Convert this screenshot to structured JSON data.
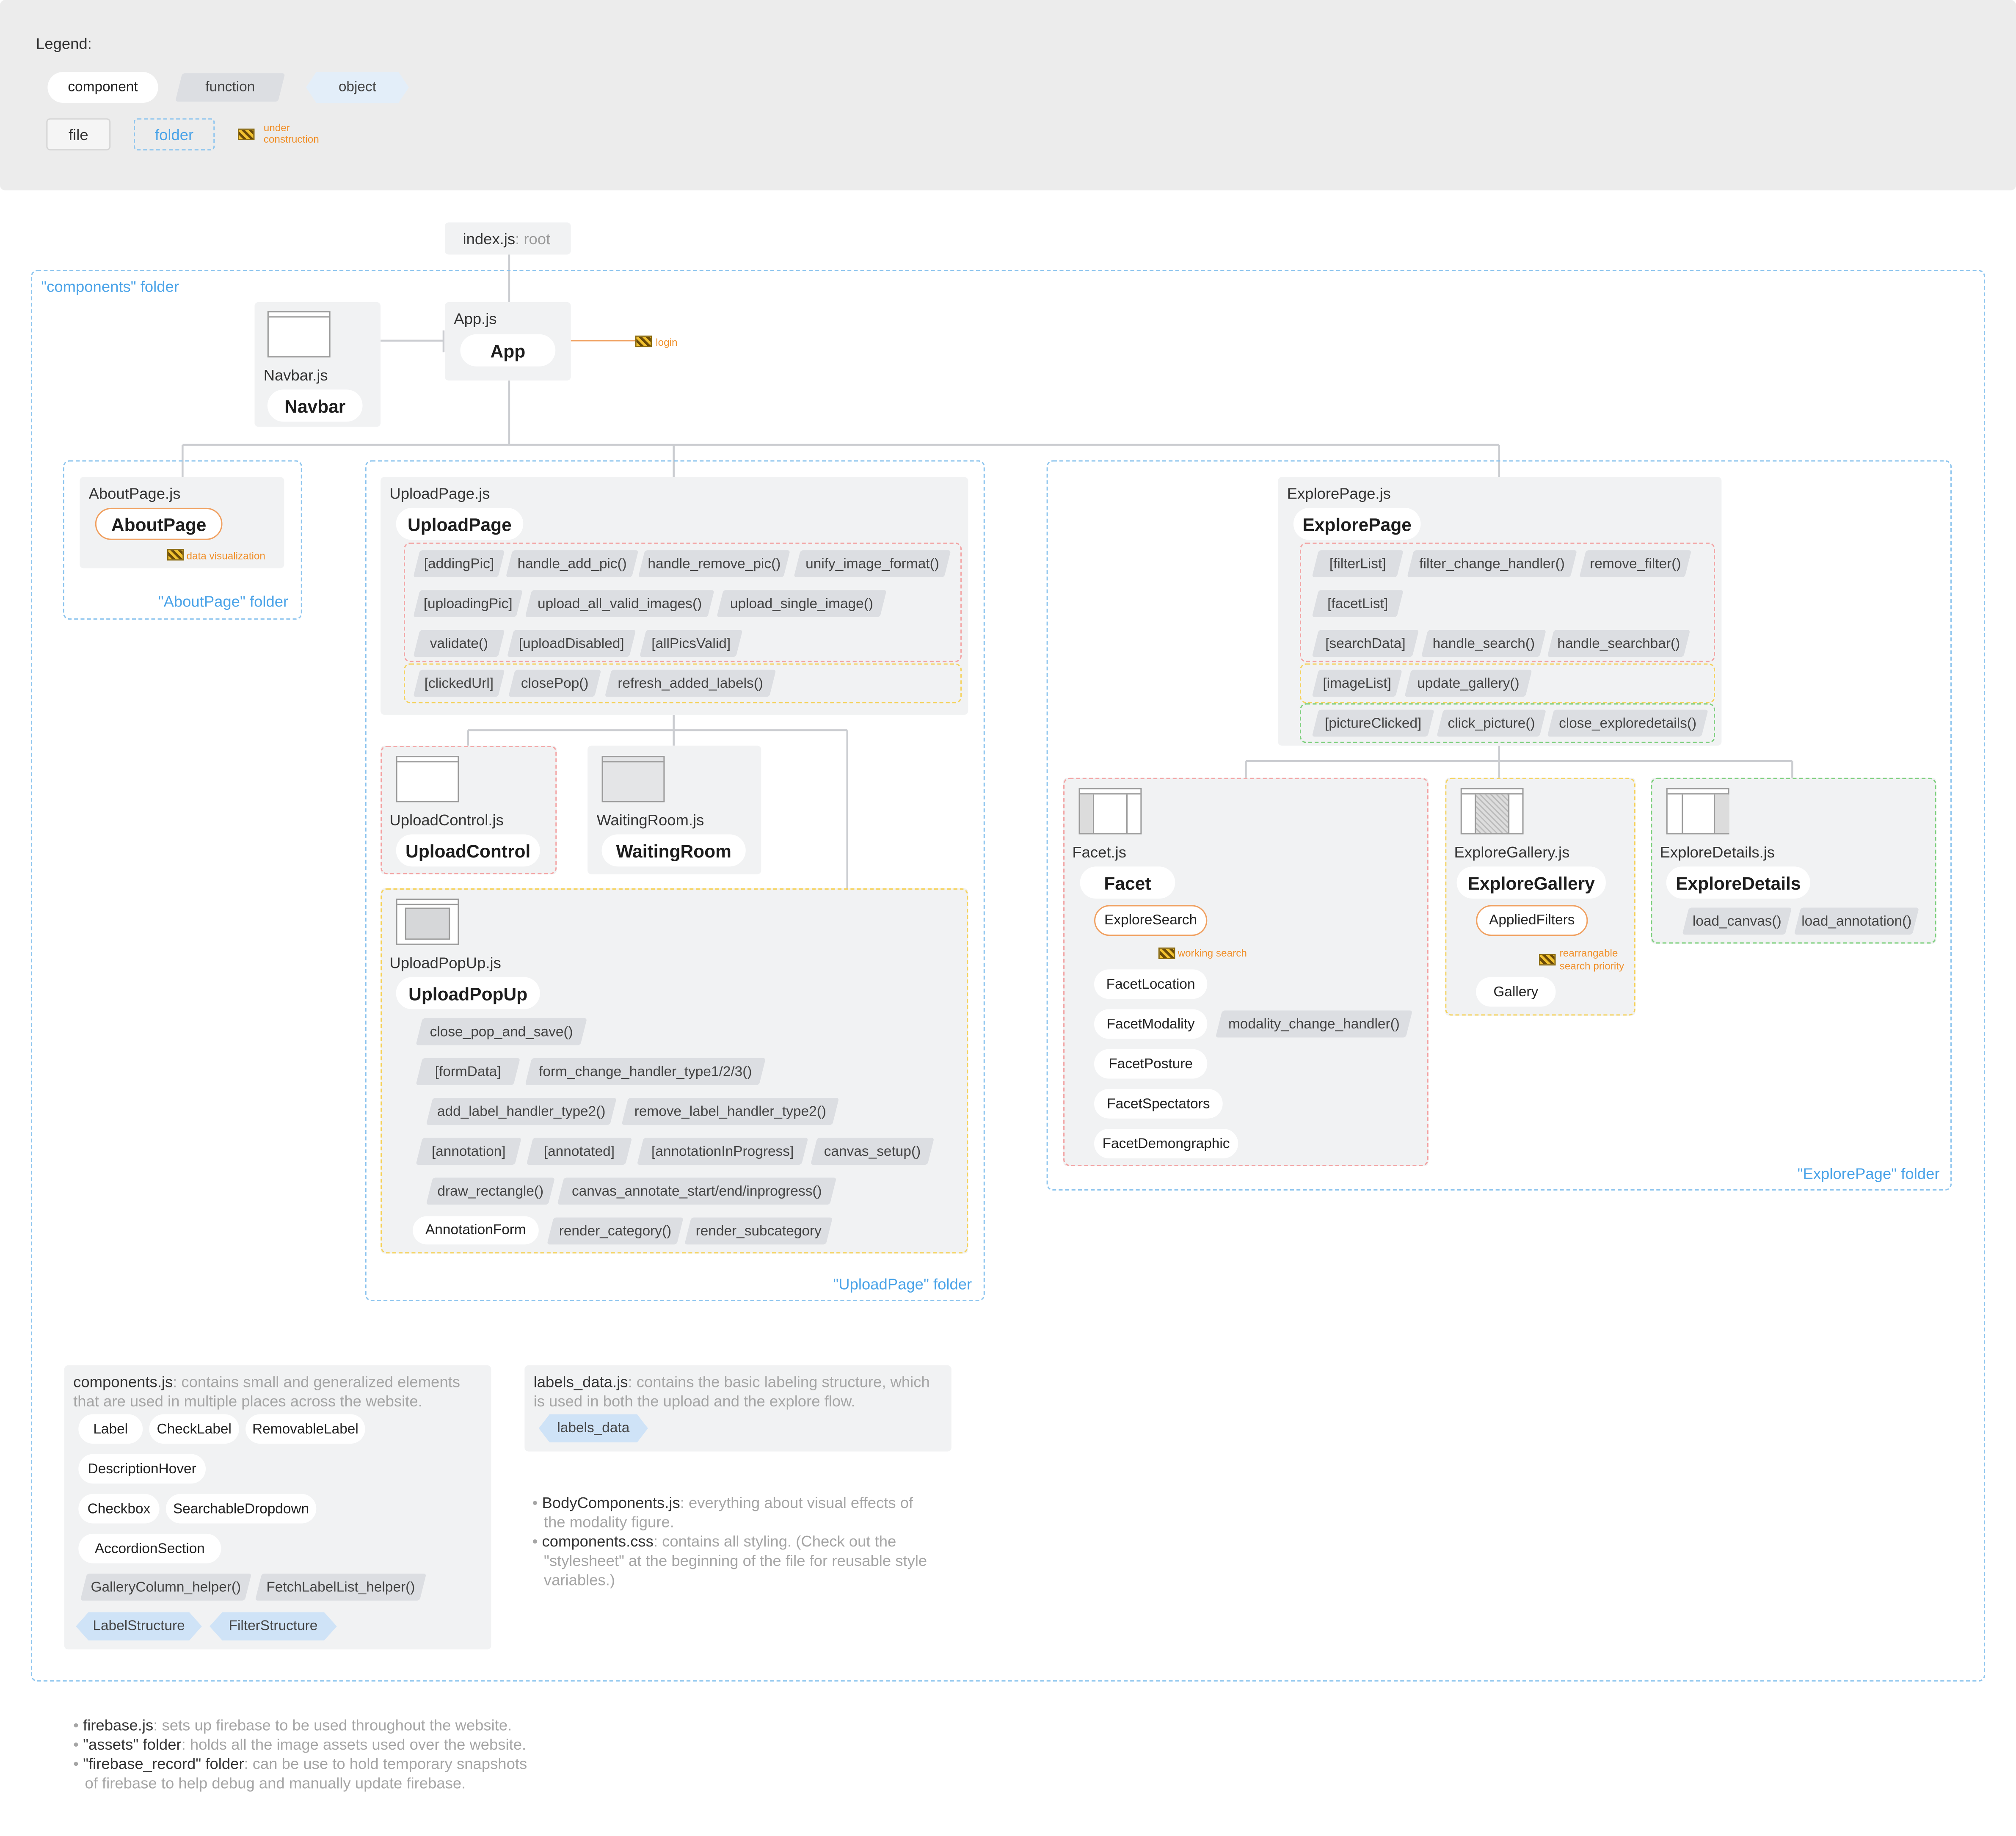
{
  "legend": {
    "title": "Legend:",
    "component": "component",
    "function": "function",
    "object": "object",
    "file": "file",
    "folder": "folder",
    "under_construction": "under construction"
  },
  "root": {
    "file": "index.js",
    "suffix": ": root"
  },
  "components_folder": "\"components\" folder",
  "app": {
    "file": "App.js",
    "name": "App",
    "note": "login"
  },
  "navbar": {
    "file": "Navbar.js",
    "name": "Navbar"
  },
  "about": {
    "file": "AboutPage.js",
    "name": "AboutPage",
    "note": "data visualization",
    "folder": "\"AboutPage\" folder"
  },
  "upload": {
    "file": "UploadPage.js",
    "name": "UploadPage",
    "folder": "\"UploadPage\" folder",
    "row1": [
      "[addingPic]",
      "handle_add_pic()",
      "handle_remove_pic()",
      "unify_image_format()"
    ],
    "row2": [
      "[uploadingPic]",
      "upload_all_valid_images()",
      "upload_single_image()"
    ],
    "row3": [
      "validate()",
      "[uploadDisabled]",
      "[allPicsValid]"
    ],
    "row4": [
      "[clickedUrl]",
      "closePop()",
      "refresh_added_labels()"
    ]
  },
  "upload_control": {
    "file": "UploadControl.js",
    "name": "UploadControl"
  },
  "waiting_room": {
    "file": "WaitingRoom.js",
    "name": "WaitingRoom"
  },
  "upload_popup": {
    "file": "UploadPopUp.js",
    "name": "UploadPopUp",
    "items": [
      "close_pop_and_save()",
      "[formData]",
      "form_change_handler_type1/2/3()",
      "add_label_handler_type2()",
      "remove_label_handler_type2()",
      "[annotation]",
      "[annotated]",
      "[annotationInProgress]",
      "canvas_setup()",
      "draw_rectangle()",
      "canvas_annotate_start/end/inprogress()",
      "render_category()",
      "render_subcategory"
    ],
    "form": "AnnotationForm"
  },
  "explore": {
    "file": "ExplorePage.js",
    "name": "ExplorePage",
    "folder": "\"ExplorePage\" folder",
    "row1": [
      "[filterList]",
      "filter_change_handler()",
      "remove_filter()"
    ],
    "row2": [
      "[facetList]"
    ],
    "row3": [
      "[searchData]",
      "handle_search()",
      "handle_searchbar()"
    ],
    "row4": [
      "[imageList]",
      "update_gallery()"
    ],
    "row5": [
      "[pictureClicked]",
      "click_picture()",
      "close_exploredetails()"
    ]
  },
  "facet": {
    "file": "Facet.js",
    "name": "Facet",
    "search": "ExploreSearch",
    "search_note": "working search",
    "items": [
      "FacetLocation",
      "FacetModality",
      "FacetPosture",
      "FacetSpectators",
      "FacetDemongraphic"
    ],
    "modality_handler": "modality_change_handler()"
  },
  "gallery": {
    "file": "ExploreGallery.js",
    "name": "ExploreGallery",
    "filters": "AppliedFilters",
    "note1": "rearrangable",
    "note2": "search priority",
    "gallery": "Gallery"
  },
  "details": {
    "file": "ExploreDetails.js",
    "name": "ExploreDetails",
    "fn1": "load_canvas()",
    "fn2": "load_annotation()"
  },
  "components_js": {
    "file": "components.js",
    "desc1": ": contains small and generalized elements",
    "desc2": "that are used in multiple places across the website.",
    "comps": [
      "Label",
      "CheckLabel",
      "RemovableLabel",
      "DescriptionHover",
      "Checkbox",
      "SearchableDropdown",
      "AccordionSection"
    ],
    "funcs": [
      "GalleryColumn_helper()",
      "FetchLabelList_helper()"
    ],
    "objs": [
      "LabelStructure",
      "FilterStructure"
    ]
  },
  "labels_data": {
    "file": "labels_data.js",
    "desc1": ": contains the basic labeling structure, which",
    "desc2": "is used in both the upload and the explore flow.",
    "obj": "labels_data"
  },
  "notes_mid": {
    "n1a": "BodyComponents.js",
    "n1b": ": everything about visual effects of",
    "n1c": "the modality figure.",
    "n2a": "components.css",
    "n2b": ": contains all styling. (Check out the",
    "n2c": "\"stylesheet\" at the beginning of the file for reusable style",
    "n2d": "variables.)"
  },
  "notes_bottom": {
    "n1a": "firebase.js",
    "n1b": ": sets up firebase to be used throughout the website.",
    "n2a": "\"assets\" folder",
    "n2b": ": holds all the image assets used over the website.",
    "n3a": "\"firebase_record\" folder",
    "n3b": ": can be use to hold temporary snapshots",
    "n3c": "of firebase to help debug and manually update firebase."
  }
}
